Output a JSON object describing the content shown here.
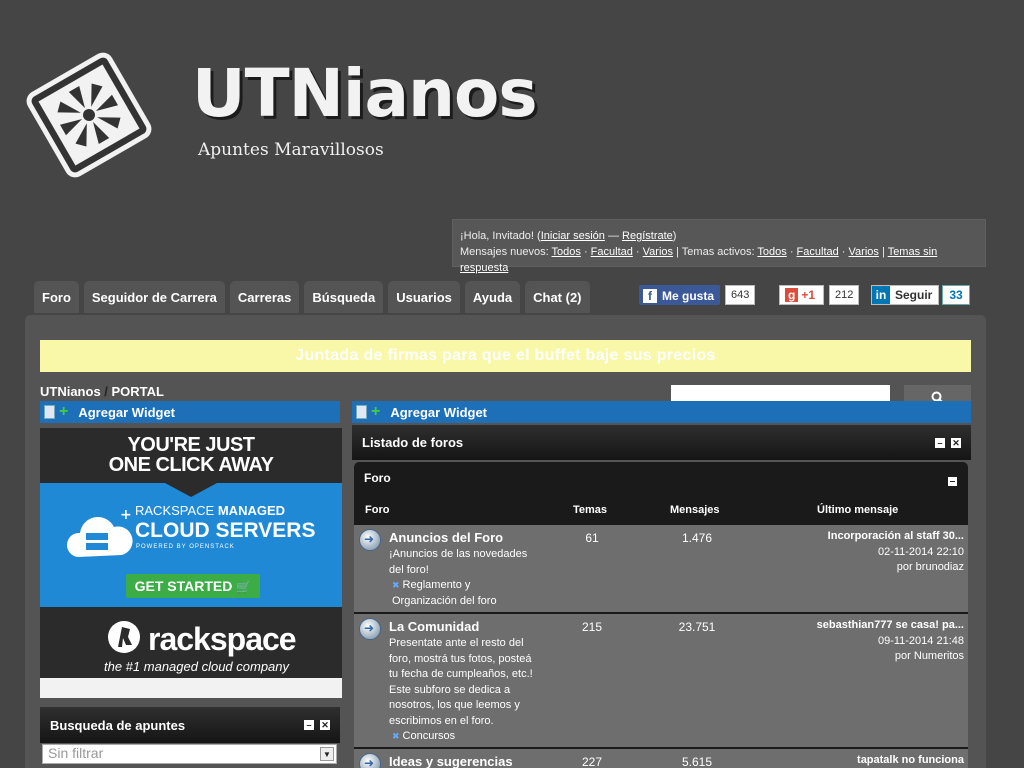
{
  "header": {
    "title": "UTNianos",
    "subtitle": "Apuntes Maravillosos"
  },
  "userbox": {
    "greeting": "¡Hola, Invitado! (",
    "login": "Iniciar sesión",
    "dash": " — ",
    "register": "Regístrate",
    "close": ")",
    "new_label": "Mensajes nuevos: ",
    "new_all": "Todos",
    "new_fac": "Facultad",
    "new_var": "Varios",
    "active_label": " | Temas activos: ",
    "act_all": "Todos",
    "act_fac": "Facultad",
    "act_var": "Varios",
    "sep": " | ",
    "no_reply": "Temas sin respuesta",
    "dot": " · "
  },
  "nav": [
    "Foro",
    "Seguidor de Carrera",
    "Carreras",
    "Búsqueda",
    "Usuarios",
    "Ayuda",
    "Chat (2)"
  ],
  "social": {
    "fb_label": "Me gusta",
    "fb_count": "643",
    "gp_label": "+1",
    "gp_count": "212",
    "in_label": "Seguir",
    "in_count": "33"
  },
  "banner": "Juntada de firmas para que el buffet baje sus precios",
  "breadcrumb": {
    "root": "UTNianos",
    "sep": " / ",
    "current": "PORTAL"
  },
  "widgets": {
    "add_left": "Agregar Widget",
    "add_right": "Agregar Widget"
  },
  "ad": {
    "headline1": "YOU'RE JUST",
    "headline2": "ONE CLICK AWAY",
    "line1": "RACKSPACE",
    "line1b": " MANAGED",
    "line2": "CLOUD SERVERS",
    "line3": "POWERED BY OPENSTACK",
    "cta": "GET STARTED",
    "brand": "rackspace",
    "tagline": "the #1 managed cloud company"
  },
  "busqueda": {
    "title": "Busqueda de apuntes",
    "select": "Sin filtrar"
  },
  "listado": {
    "title": "Listado de foros"
  },
  "foro": {
    "title": "Foro",
    "columns": [
      "Foro",
      "Temas",
      "Mensajes",
      "Último mensaje"
    ],
    "rows": [
      {
        "name": "Anuncios del Foro",
        "desc": "¡Anuncios de las novedades del foro!",
        "sub": "Reglamento y Organización del foro",
        "temas": "61",
        "mensajes": "1.476",
        "last_title": "Incorporación al staff 30...",
        "last_date": "02-11-2014 22:10",
        "por": "por",
        "last_user": "brunodiaz"
      },
      {
        "name": "La Comunidad",
        "desc": "Presentate ante el resto del foro, mostrá tus fotos, posteá tu fecha de cumpleaños, etc.! Este subforo se dedica a nosotros, los que leemos y escribimos en el foro.",
        "sub": "Concursos",
        "temas": "215",
        "mensajes": "23.751",
        "last_title": "sebasthian777 se casa! pa...",
        "last_date": "09-11-2014 21:48",
        "por": "por",
        "last_user": "Numeritos"
      },
      {
        "name": "Ideas y sugerencias",
        "temas": "227",
        "mensajes": "5.615",
        "last_title": "tapatalk no funciona"
      }
    ]
  }
}
